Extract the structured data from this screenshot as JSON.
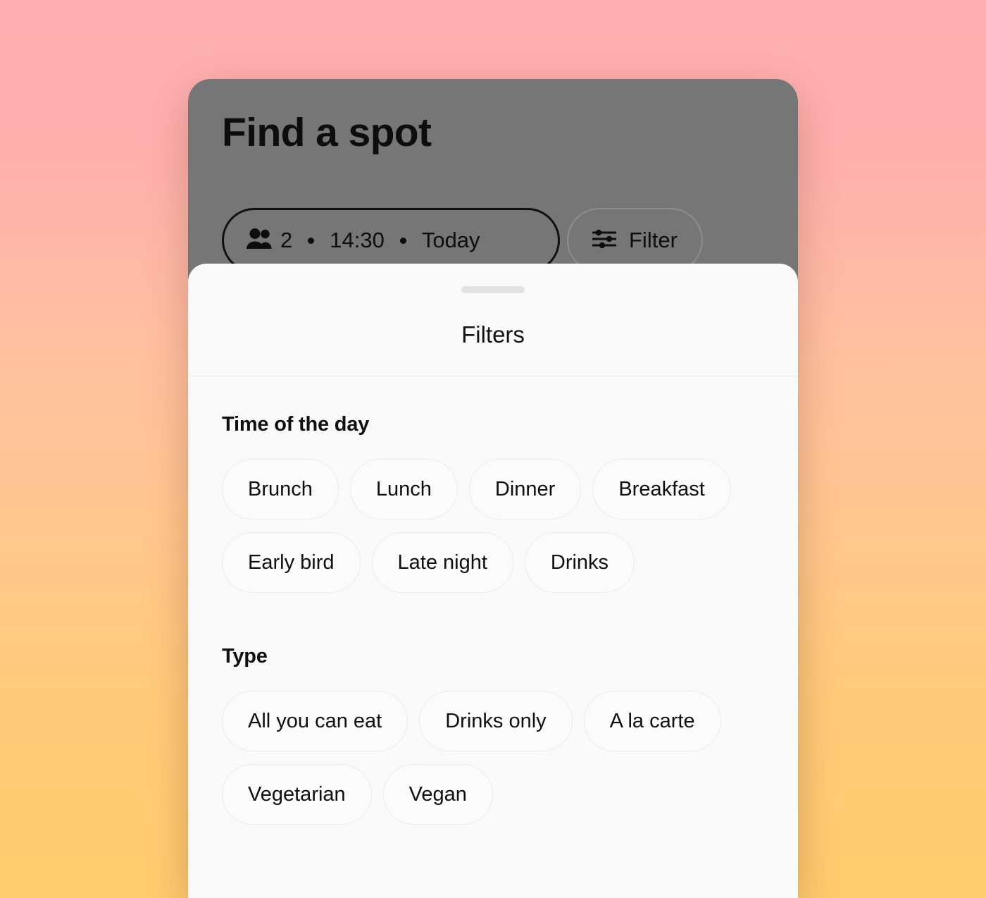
{
  "background": {
    "gradient_top": "#ffafb2",
    "gradient_bottom": "#ffcc6e"
  },
  "discover_screen": {
    "title": "Find a spot",
    "overlay_color": "#767676",
    "search_pill": {
      "guests_icon": "people-icon",
      "guests": "2",
      "time": "14:30",
      "date": "Today"
    },
    "filter_button": {
      "icon": "sliders-icon",
      "label": "Filter"
    }
  },
  "filter_sheet": {
    "handle": "drag-handle",
    "title": "Filters",
    "sections": [
      {
        "id": "time-of-the-day",
        "title": "Time of the day",
        "chips": [
          "Brunch",
          "Lunch",
          "Dinner",
          "Breakfast",
          "Early bird",
          "Late night",
          "Drinks"
        ]
      },
      {
        "id": "type",
        "title": "Type",
        "chips": [
          "All you can eat",
          "Drinks only",
          "A la carte",
          "Vegetarian",
          "Vegan"
        ]
      }
    ]
  }
}
